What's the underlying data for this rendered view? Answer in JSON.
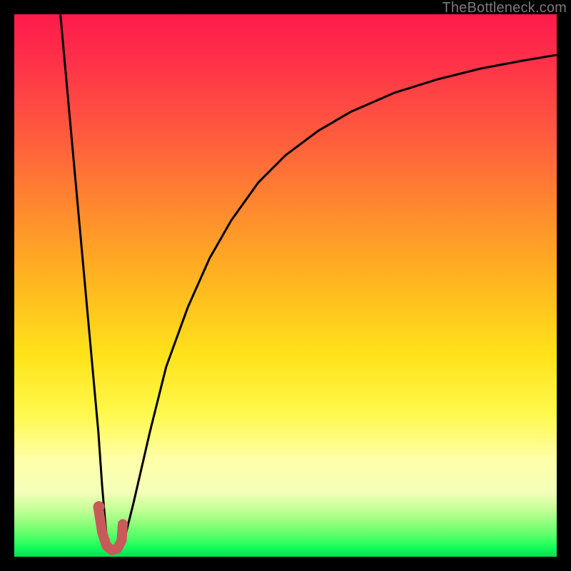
{
  "watermark": "TheBottleneck.com",
  "chart_data": {
    "type": "line",
    "title": "",
    "xlabel": "",
    "ylabel": "",
    "xlim": [
      0,
      100
    ],
    "ylim": [
      0,
      100
    ],
    "gradient_meaning": "background color maps y from 0 (green, good) to 100 (red, bad)",
    "series": [
      {
        "name": "left-branch",
        "x": [
          8.5,
          9.5,
          10.5,
          11.5,
          12.5,
          13.5,
          14.5,
          15.5,
          16.2,
          16.8,
          17.2
        ],
        "values": [
          100,
          89,
          78,
          67,
          56,
          45,
          34,
          23,
          13,
          6,
          2
        ]
      },
      {
        "name": "right-branch",
        "x": [
          20,
          22,
          25,
          28,
          32,
          36,
          40,
          45,
          50,
          56,
          62,
          70,
          78,
          86,
          94,
          100
        ],
        "values": [
          2,
          10,
          23,
          35,
          46,
          55,
          62,
          69,
          74,
          78.5,
          82,
          85.5,
          88,
          90,
          91.5,
          92.5
        ]
      },
      {
        "name": "marker-stroke",
        "x": [
          15.5,
          16.2,
          17.0,
          18.0,
          19.0,
          19.8,
          20.0
        ],
        "values": [
          9.0,
          4.5,
          2.0,
          1.2,
          1.5,
          3.0,
          6.0
        ]
      }
    ],
    "markers": [
      {
        "name": "dot",
        "x": 15.6,
        "y": 9.2
      }
    ]
  },
  "colors": {
    "curve": "#000000",
    "marker": "#c85a5a"
  }
}
